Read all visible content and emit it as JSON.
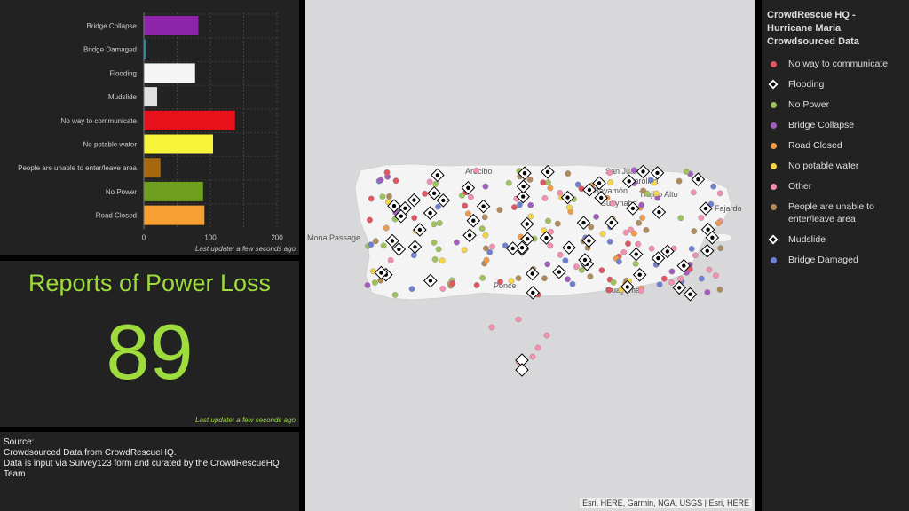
{
  "chart_data": {
    "type": "bar",
    "orientation": "horizontal",
    "categories": [
      "Bridge Collapse",
      "Bridge Damaged",
      "Flooding",
      "Mudslide",
      "No way to communicate",
      "No potable water",
      "People are unable to enter/leave area",
      "No Power",
      "Road Closed"
    ],
    "values": [
      82,
      3,
      77,
      20,
      137,
      104,
      25,
      89,
      91
    ],
    "colors": [
      "#8e24aa",
      "#0097a7",
      "#f5f5f5",
      "#e0e0e0",
      "#e8101b",
      "#f7f53a",
      "#a8680f",
      "#6e9f1e",
      "#f5a031"
    ],
    "xlim": [
      0,
      200
    ],
    "xticks": [
      "0",
      "100",
      "200"
    ],
    "grid": true
  },
  "chart_panel": {
    "last_update": "Last update: a few seconds ago"
  },
  "kpi": {
    "title": "Reports of Power Loss",
    "value": "89",
    "last_update": "Last update: a few seconds ago",
    "color": "#9edb3c"
  },
  "source": {
    "line1": "Source:",
    "line2": "Crowdsourced Data from CrowdRescueHQ.",
    "line3": "Data is input via Survey123 form and curated by the CrowdRescueHQ Team"
  },
  "map": {
    "attribution": "Esri, HERE, Garmin, NGA, USGS | Esri, HERE",
    "place_labels": [
      "Arecibo",
      "San Juan",
      "Carolina",
      "Bayamón",
      "Trujillo Alto",
      "Guaynabo",
      "Fajardo",
      "Mona Passage",
      "Ponce",
      "Guayama"
    ]
  },
  "legend": {
    "title": "CrowdRescue HQ - Hurricane Maria Crowdsourced Data",
    "items": [
      {
        "label": "No way to communicate",
        "symbol": "dot",
        "color": "#e05561"
      },
      {
        "label": "Flooding",
        "symbol": "diamond",
        "color": "#ffffff"
      },
      {
        "label": "No Power",
        "symbol": "dot",
        "color": "#9dc35a"
      },
      {
        "label": "Bridge Collapse",
        "symbol": "dot",
        "color": "#a35dbd"
      },
      {
        "label": "Road Closed",
        "symbol": "dot",
        "color": "#f09a4a"
      },
      {
        "label": "No potable water",
        "symbol": "dot",
        "color": "#f5d547"
      },
      {
        "label": "Other",
        "symbol": "dot",
        "color": "#f48fb1"
      },
      {
        "label": "People are unable to enter/leave area",
        "symbol": "dot",
        "color": "#b08a5a"
      },
      {
        "label": "Mudslide",
        "symbol": "diamond",
        "color": "#ffffff"
      },
      {
        "label": "Bridge Damaged",
        "symbol": "dot",
        "color": "#6f7fd3"
      }
    ]
  }
}
